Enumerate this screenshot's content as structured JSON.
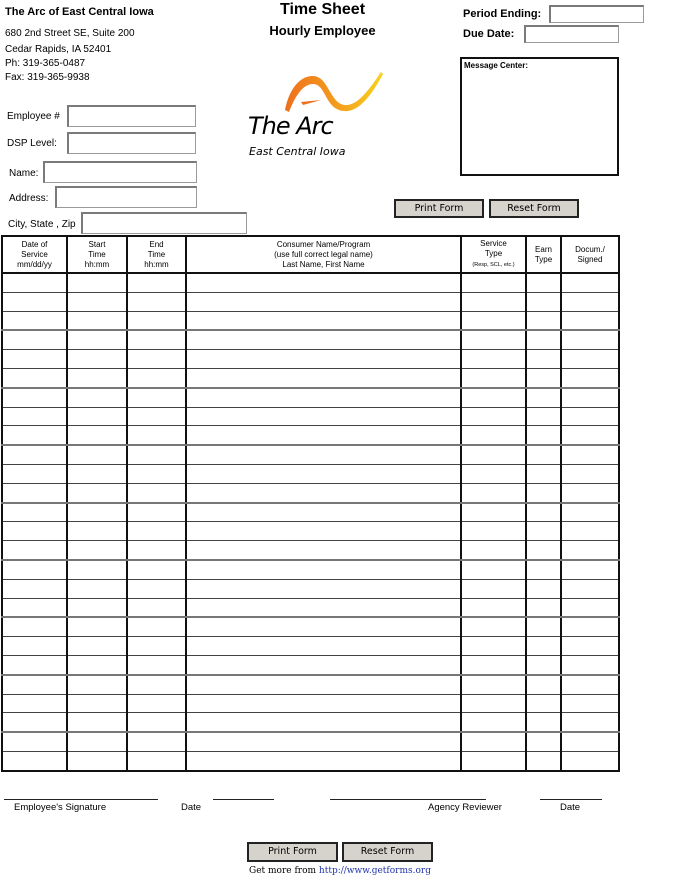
{
  "header": {
    "org_name": "The Arc of East Central Iowa",
    "address_line1": "680 2nd Street SE, Suite 200",
    "address_line2": "Cedar Rapids, IA 52401",
    "phone": "Ph:  319-365-0487",
    "fax": "Fax:  319-365-9938",
    "title": "Time Sheet",
    "subtitle": "Hourly Employee"
  },
  "logo": {
    "name": "The Arc",
    "tagline": "East Central Iowa",
    "colors": {
      "orange": "#f07c1e",
      "yellow": "#f7c21a"
    }
  },
  "period": {
    "period_ending_label": "Period Ending:",
    "period_ending_value": "",
    "due_date_label": "Due Date:",
    "due_date_value": ""
  },
  "message_center": {
    "label": "Message Center:",
    "value": ""
  },
  "employee": {
    "employee_number_label": "Employee #",
    "employee_number_value": "",
    "dsp_level_label": "DSP Level:",
    "dsp_level_value": "",
    "name_label": "Name:",
    "name_value": "",
    "address_label": "Address:",
    "address_value": "",
    "city_state_zip_label": "City, State , Zip",
    "city_state_zip_value": ""
  },
  "buttons": {
    "print": "Print Form",
    "reset": "Reset Form"
  },
  "table": {
    "columns": [
      {
        "line1": "Date of",
        "line2": "Service",
        "line3": "mm/dd/yy"
      },
      {
        "line1": "Start",
        "line2": "Time",
        "line3": "hh:mm"
      },
      {
        "line1": "End",
        "line2": "Time",
        "line3": "hh:mm"
      },
      {
        "line1": "Consumer Name/Program",
        "line2": "(use full correct legal name)",
        "line3": "Last Name,    First Name"
      },
      {
        "line1": "Service",
        "line2": "Type",
        "line3": "(Resp, SCL, etc.)"
      },
      {
        "line1": "",
        "line2": "Earn",
        "line3": "Type"
      },
      {
        "line1": "",
        "line2": "Docum./",
        "line3": "Signed"
      }
    ],
    "row_count": 26
  },
  "signatures": {
    "employee_signature": "Employee's Signature",
    "date1": "Date",
    "agency_reviewer": "Agency Reviewer",
    "date2": "Date"
  },
  "footer": {
    "prefix": "Get more from ",
    "link": "http://www.getforms.org"
  }
}
